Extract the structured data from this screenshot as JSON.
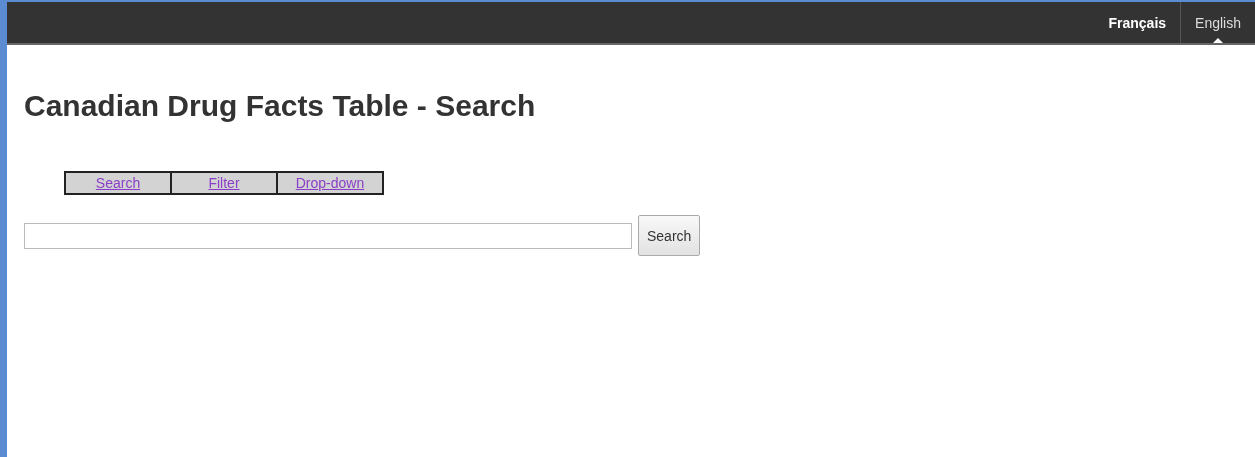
{
  "languages": [
    {
      "label": "Français",
      "selected": false
    },
    {
      "label": "English",
      "selected": true
    }
  ],
  "title": "Canadian Drug Facts Table - Search",
  "tabs": [
    {
      "label": "Search"
    },
    {
      "label": "Filter"
    },
    {
      "label": "Drop-down"
    }
  ],
  "search": {
    "button": "Search"
  }
}
